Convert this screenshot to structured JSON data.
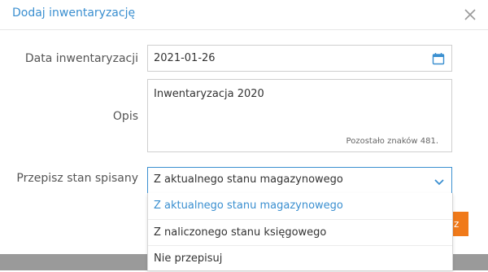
{
  "dialog": {
    "title": "Dodaj inwentaryzację"
  },
  "form": {
    "date_label": "Data inwentaryzacji",
    "date_value": "2021-01-26",
    "description_label": "Opis",
    "description_value": "Inwentaryzacja 2020",
    "remaining_chars": "Pozostało znaków 481.",
    "stock_label": "Przepisz stan spisany",
    "stock_selected": "Z aktualnego stanu magazynowego",
    "stock_options": [
      "Z aktualnego stanu magazynowego",
      "Z naliczonego stanu księgowego",
      "Nie przepisuj"
    ]
  },
  "footer": {
    "button_partial": "z"
  },
  "colors": {
    "accent": "#3a8fd0",
    "button": "#f07a1a"
  },
  "icons": [
    "close-icon",
    "calendar-icon",
    "chevron-down-icon"
  ]
}
